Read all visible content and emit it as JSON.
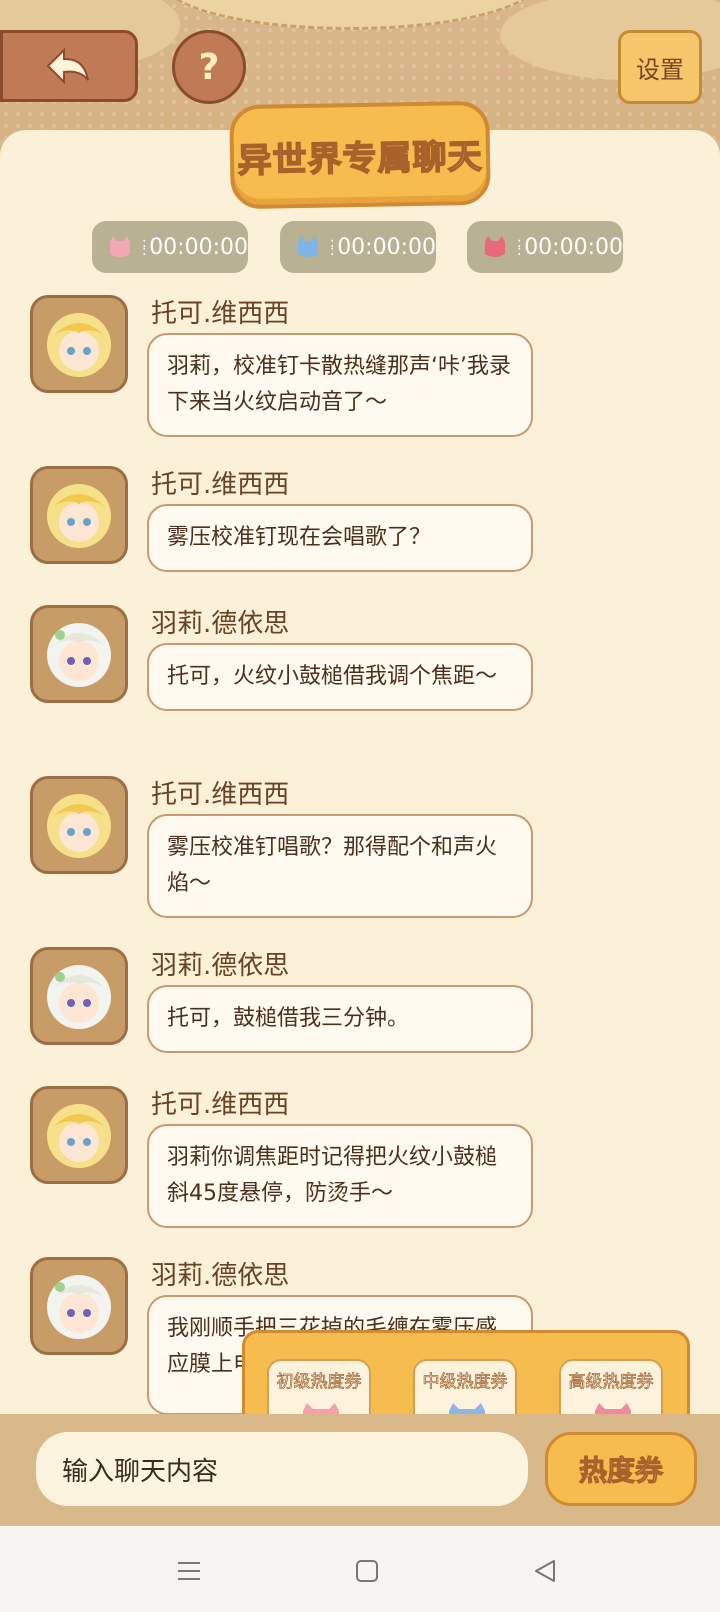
{
  "header": {
    "back_icon": "back-arrow-icon",
    "help_label": "?",
    "settings_label": "设置"
  },
  "title": "异世界专属聊天",
  "timers": [
    {
      "value": "00:00:00",
      "color": "#f2a9b4"
    },
    {
      "value": "00:00:00",
      "color": "#7fb4e6"
    },
    {
      "value": "00:00:00",
      "color": "#e86a7a"
    }
  ],
  "messages": [
    {
      "sender": "托可.维西西",
      "text": "羽莉，校准钉卡散热缝那声‘咔’我录下来当火纹启动音了～",
      "avatar": "blonde"
    },
    {
      "sender": "托可.维西西",
      "text": "雾压校准钉现在会唱歌了？",
      "avatar": "blonde"
    },
    {
      "sender": "羽莉.德依思",
      "text": "托可，火纹小鼓槌借我调个焦距～",
      "avatar": "white"
    },
    {
      "sender": "托可.维西西",
      "text": "雾压校准钉唱歌？那得配个和声火焰～",
      "avatar": "blonde"
    },
    {
      "sender": "羽莉.德依思",
      "text": "托可，鼓槌借我三分钟。",
      "avatar": "white"
    },
    {
      "sender": "托可.维西西",
      "text": "羽莉你调焦距时记得把火纹小鼓槌斜45度悬停，防烫手～",
      "avatar": "blonde"
    },
    {
      "sender": "羽莉.德依思",
      "text": "我刚顺手把三花掉的毛缠在雾压感应膜上电蓝闪…",
      "avatar": "white"
    }
  ],
  "coupons": [
    {
      "label": "初级热度券",
      "color": "#f4a0b0"
    },
    {
      "label": "中级热度券",
      "color": "#8fb4ea"
    },
    {
      "label": "高级热度券",
      "color": "#f08aa0"
    }
  ],
  "input": {
    "placeholder": "输入聊天内容",
    "heat_button": "热度券"
  },
  "nav": [
    "menu-icon",
    "home-square-icon",
    "back-triangle-icon"
  ]
}
